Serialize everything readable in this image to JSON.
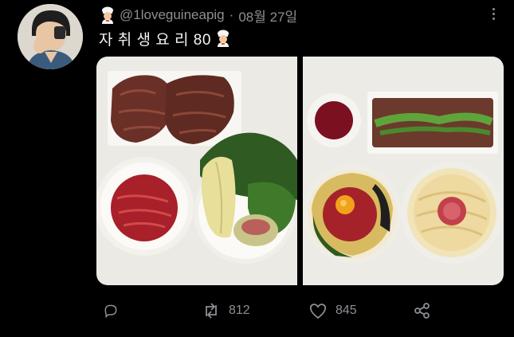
{
  "tweet": {
    "handle": "@1loveguineapig",
    "separator": "·",
    "date": "08월 27일",
    "text": "자 취 생 요 리 80"
  },
  "actions": {
    "retweet_count": "812",
    "like_count": "845"
  },
  "colors": {
    "background": "#000000",
    "muted": "#8b8f94",
    "text": "#f4f4f4"
  },
  "icons": [
    "chef-emoji-icon",
    "more-icon",
    "reply-icon",
    "retweet-icon",
    "like-icon",
    "share-icon"
  ]
}
